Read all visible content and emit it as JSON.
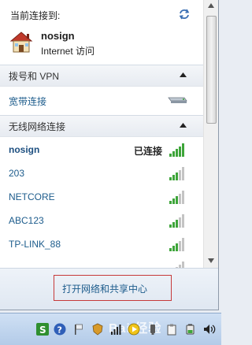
{
  "header": {
    "current_label": "当前连接到:",
    "network_name": "nosign",
    "network_access": "Internet 访问"
  },
  "dialup": {
    "section_title": "拨号和 VPN",
    "item": "宽带连接"
  },
  "wireless": {
    "section_title": "无线网络连接",
    "networks": [
      {
        "name": "nosign",
        "status": "已连接",
        "connected": true
      },
      {
        "name": "203",
        "status": "",
        "connected": false
      },
      {
        "name": "NETCORE",
        "status": "",
        "connected": false
      },
      {
        "name": "ABC123",
        "status": "",
        "connected": false
      },
      {
        "name": "TP-LINK_88",
        "status": "",
        "connected": false
      }
    ]
  },
  "footer": {
    "open_center_label": "打开网络和共享中心"
  },
  "taskbar": {
    "watermark": "Bai 经验"
  },
  "colors": {
    "link": "#1d5c8c",
    "signal_green": "#3ea53a",
    "highlight_border": "#c63a3a"
  }
}
